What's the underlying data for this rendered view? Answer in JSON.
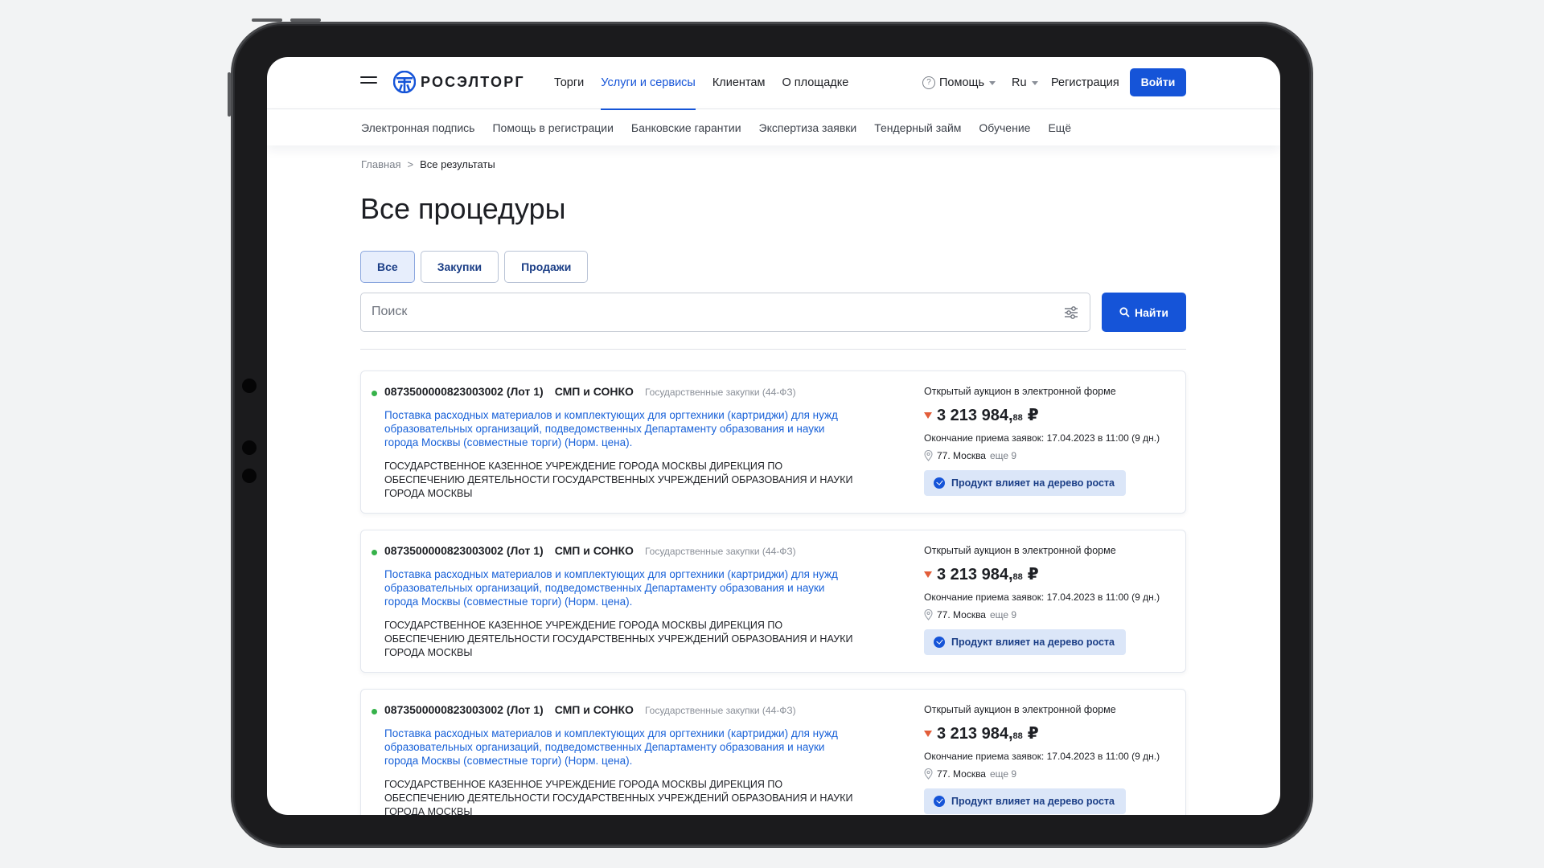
{
  "brand": {
    "name": "РОСЭЛТОРГ",
    "color": "#1554d8"
  },
  "header": {
    "nav": [
      {
        "label": "Торги",
        "active": false
      },
      {
        "label": "Услуги и сервисы",
        "active": true
      },
      {
        "label": "Клиентам",
        "active": false
      },
      {
        "label": "О площадке",
        "active": false
      }
    ],
    "help_label": "Помощь",
    "lang_label": "Ru",
    "register_label": "Регистрация",
    "login_label": "Войти"
  },
  "subnav": [
    "Электронная подпись",
    "Помощь в регистрации",
    "Банковские гарантии",
    "Экспертиза заявки",
    "Тендерный займ",
    "Обучение",
    "Ещё"
  ],
  "breadcrumb": {
    "home": "Главная",
    "separator": ">",
    "current": "Все результаты"
  },
  "page_title": "Все процедуры",
  "tabs": [
    {
      "label": "Все",
      "active": true
    },
    {
      "label": "Закупки",
      "active": false
    },
    {
      "label": "Продажи",
      "active": false
    }
  ],
  "search": {
    "placeholder": "Поиск",
    "value": "",
    "button_label": "Найти"
  },
  "procedures": [
    {
      "number": "0873500000823003002 (Лот 1)",
      "type": "СМП и СОНКО",
      "law": "Государственные закупки (44-ФЗ)",
      "title": "Поставка расходных материалов и комплектующих для оргтехники (картриджи) для нужд образовательных организаций, подведомственных Департаменту образования и науки города Москвы (совместные торги) (Норм. цена).",
      "organization": "ГОСУДАРСТВЕННОЕ КАЗЕННОЕ УЧРЕЖДЕНИЕ ГОРОДА МОСКВЫ ДИРЕКЦИЯ ПО ОБЕСПЕЧЕНИЮ ДЕЯТЕЛЬНОСТИ ГОСУДАРСТВЕННЫХ УЧРЕЖДЕНИЙ ОБРАЗОВАНИЯ И НАУКИ ГОРОДА МОСКВЫ",
      "auction_type": "Открытый аукцион в электронной форме",
      "price_main": "3 213 984,",
      "price_cents": "88",
      "currency": "₽",
      "deadline": "Окончание приема заявок: 17.04.2023 в 11:00 (9 дн.)",
      "region": "77. Москва",
      "region_more": "еще 9",
      "badge": "Продукт влияет на дерево роста"
    },
    {
      "number": "0873500000823003002 (Лот 1)",
      "type": "СМП и СОНКО",
      "law": "Государственные закупки (44-ФЗ)",
      "title": "Поставка расходных материалов и комплектующих для оргтехники (картриджи) для нужд образовательных организаций, подведомственных Департаменту образования и науки города Москвы (совместные торги) (Норм. цена).",
      "organization": "ГОСУДАРСТВЕННОЕ КАЗЕННОЕ УЧРЕЖДЕНИЕ ГОРОДА МОСКВЫ ДИРЕКЦИЯ ПО ОБЕСПЕЧЕНИЮ ДЕЯТЕЛЬНОСТИ ГОСУДАРСТВЕННЫХ УЧРЕЖДЕНИЙ ОБРАЗОВАНИЯ И НАУКИ ГОРОДА МОСКВЫ",
      "auction_type": "Открытый аукцион в электронной форме",
      "price_main": "3 213 984,",
      "price_cents": "88",
      "currency": "₽",
      "deadline": "Окончание приема заявок: 17.04.2023 в 11:00 (9 дн.)",
      "region": "77. Москва",
      "region_more": "еще 9",
      "badge": "Продукт влияет на дерево роста"
    },
    {
      "number": "0873500000823003002 (Лот 1)",
      "type": "СМП и СОНКО",
      "law": "Государственные закупки (44-ФЗ)",
      "title": "Поставка расходных материалов и комплектующих для оргтехники (картриджи) для нужд образовательных организаций, подведомственных Департаменту образования и науки города Москвы (совместные торги) (Норм. цена).",
      "organization": "ГОСУДАРСТВЕННОЕ КАЗЕННОЕ УЧРЕЖДЕНИЕ ГОРОДА МОСКВЫ ДИРЕКЦИЯ ПО ОБЕСПЕЧЕНИЮ ДЕЯТЕЛЬНОСТИ ГОСУДАРСТВЕННЫХ УЧРЕЖДЕНИЙ ОБРАЗОВАНИЯ И НАУКИ ГОРОДА МОСКВЫ",
      "auction_type": "Открытый аукцион в электронной форме",
      "price_main": "3 213 984,",
      "price_cents": "88",
      "currency": "₽",
      "deadline": "Окончание приема заявок: 17.04.2023 в 11:00 (9 дн.)",
      "region": "77. Москва",
      "region_more": "еще 9",
      "badge": "Продукт влияет на дерево роста"
    }
  ],
  "icons": {
    "menu": "hamburger-icon",
    "help": "question-circle-icon",
    "filter": "sliders-icon",
    "search": "magnifier-icon",
    "location": "map-pin-icon",
    "badge": "check-circle-icon",
    "price_trend": "arrow-down-icon"
  }
}
